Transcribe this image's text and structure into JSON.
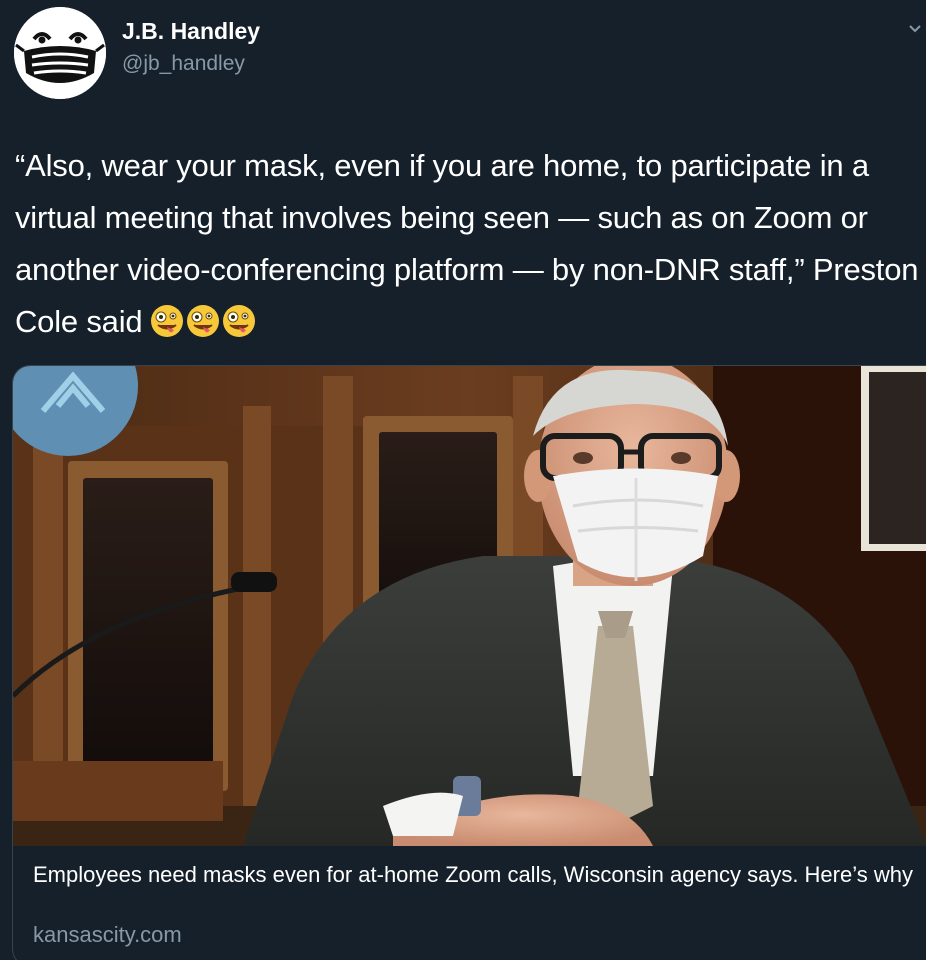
{
  "tweet": {
    "author_name": "J.B. Handley",
    "author_handle": "@jb_handley",
    "text": "“Also, wear your mask, even if you are home, to participate in a virtual meeting that involves being seen — such as on Zoom or another video-conferencing platform — by non-DNR staff,” Preston Cole said",
    "emojis": [
      "zany-face",
      "zany-face",
      "zany-face"
    ]
  },
  "card": {
    "title": "Employees need masks even for at-home Zoom calls, Wisconsin agency says. Here’s why",
    "domain": "kansascity.com",
    "image_icon": "photo-man-wearing-mask"
  },
  "colors": {
    "background": "#15202b",
    "text": "#ffffff",
    "muted": "#8899a6",
    "border": "#38444d"
  }
}
